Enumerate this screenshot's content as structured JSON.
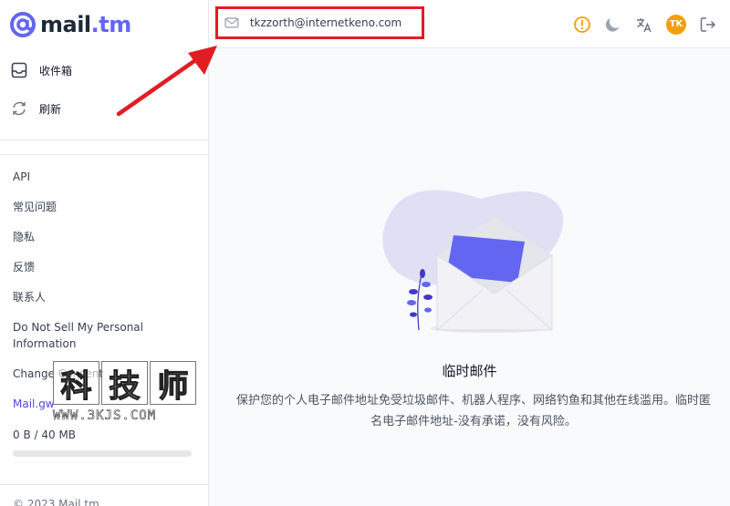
{
  "logo": {
    "name": "mail",
    "tld": ".tm"
  },
  "nav": {
    "inbox_label": "收件箱",
    "refresh_label": "刷新"
  },
  "links": {
    "api": "API",
    "faq": "常见问题",
    "privacy": "隐私",
    "feedback": "反馈",
    "contact": "联系人",
    "do_not_sell": "Do Not Sell My Personal Information",
    "change_consent": "Change Consent",
    "mail_gw": "Mail.gw"
  },
  "storage": {
    "text": "0 B / 40 MB",
    "used_fraction": 0
  },
  "copyright": "© 2023 Mail.tm",
  "watermark": {
    "chars": [
      "科",
      "技",
      "师"
    ],
    "url": "WWW.3KJS.COM"
  },
  "header": {
    "email_address": "tkzzorth@internetkeno.com",
    "avatar_initials": "TK",
    "icons": [
      "alert-icon",
      "moon-icon",
      "translate-icon",
      "avatar",
      "logout-icon"
    ]
  },
  "main": {
    "empty_title": "临时邮件",
    "empty_description": "保护您的个人电子邮件地址免受垃圾邮件、机器人程序、网络钓鱼和其他在线滥用。临时匿名电子邮件地址-没有承诺，没有风险。"
  },
  "colors": {
    "brand": "#6366f1",
    "highlight_box": "#e11d24",
    "alert": "#f59e0b",
    "avatar_bg": "#f59e0b"
  }
}
